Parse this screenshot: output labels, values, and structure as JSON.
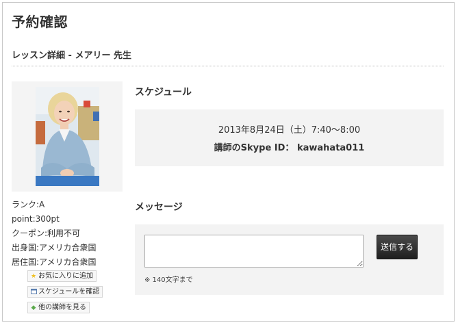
{
  "page": {
    "title": "予約確認",
    "lesson_title": "レッスン詳細 - メアリー 先生"
  },
  "teacher": {
    "photo_alt": "メアリー",
    "rank": "ランク:A",
    "point": "point:300pt",
    "coupon": "クーポン:利用不可",
    "origin": "出身国:アメリカ合衆国",
    "residence": "居住国:アメリカ合衆国"
  },
  "side_buttons": {
    "favorite": {
      "label": "お気に入りに追加",
      "icon": "star-icon"
    },
    "schedule": {
      "label": "スケジュールを確認",
      "icon": "calendar-icon"
    },
    "others": {
      "label": "他の講師を見る",
      "icon": "diamond-icon"
    }
  },
  "schedule": {
    "heading": "スケジュール",
    "datetime": "2013年8月24日（土）7:40〜8:00",
    "skype_label": "講師のSkype ID：",
    "skype_id": "kawahata011"
  },
  "message": {
    "heading": "メッセージ",
    "input_value": "",
    "hint": "※ 140文字まで",
    "send_label": "送信する"
  },
  "colors": {
    "accent_star": "#f0c020",
    "accent_diamond": "#5aa84a",
    "send_button": "#2a2a2a",
    "panel_bg": "#f3f3f3"
  }
}
